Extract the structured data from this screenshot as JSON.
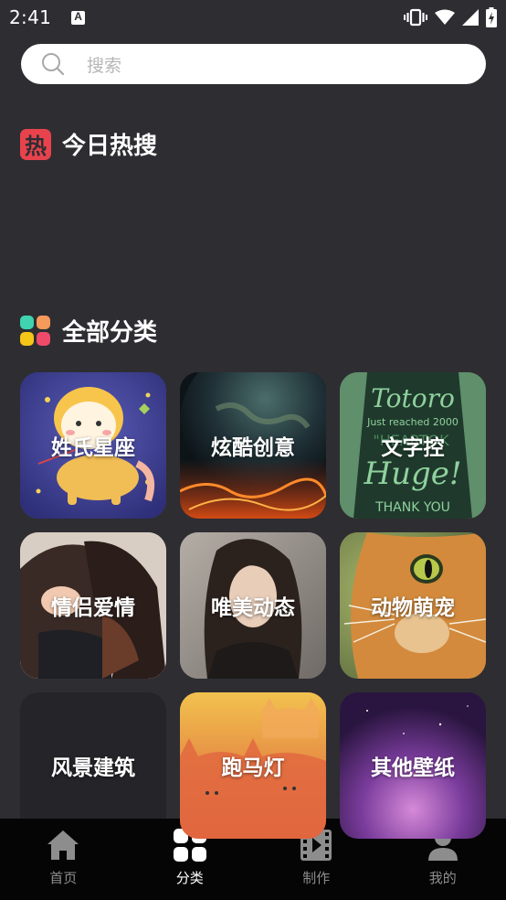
{
  "status_bar": {
    "time": "2:41",
    "icons": [
      "app-notification-icon",
      "vibrate-icon",
      "wifi-icon",
      "signal-icon",
      "battery-charging-icon"
    ]
  },
  "search": {
    "placeholder": "搜索",
    "icon": "search-icon"
  },
  "hot_section": {
    "title": "今日热搜",
    "icon": "hot-icon",
    "icon_glyph": "热",
    "icon_color": "#e8434d"
  },
  "categories_section": {
    "title": "全部分类",
    "icon": "grid-icon",
    "icon_colors": [
      "#3fd3b0",
      "#f59a5b",
      "#f5c518",
      "#ef4a6a"
    ],
    "items": [
      {
        "label": "姓氏星座"
      },
      {
        "label": "炫酷创意"
      },
      {
        "label": "文字控"
      },
      {
        "label": "情侣爱情"
      },
      {
        "label": "唯美动态"
      },
      {
        "label": "动物萌宠"
      },
      {
        "label": "风景建筑"
      },
      {
        "label": "跑马灯"
      },
      {
        "label": "其他壁纸"
      }
    ]
  },
  "bottom_nav": {
    "items": [
      {
        "label": "首页",
        "icon": "home-icon"
      },
      {
        "label": "分类",
        "icon": "category-grid-icon"
      },
      {
        "label": "制作",
        "icon": "video-clapper-icon"
      },
      {
        "label": "我的",
        "icon": "profile-icon"
      }
    ],
    "active": "分类"
  }
}
